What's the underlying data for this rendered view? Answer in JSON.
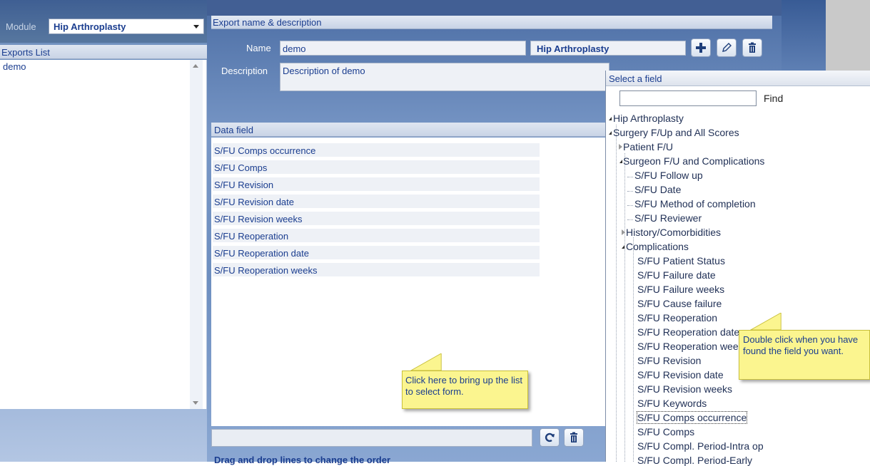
{
  "left_panel": {
    "module_label": "Module",
    "module_value": "Hip Arthroplasty",
    "exports_header": "Exports List",
    "exports": [
      "demo"
    ]
  },
  "export_section": {
    "header": "Export name & description",
    "name_label": "Name",
    "name_value": "demo",
    "module_name": "Hip Arthroplasty",
    "description_label": "Description",
    "description_value": "Description of demo",
    "toolbar_icons": [
      "plus-icon",
      "pencil-icon",
      "trash-icon"
    ]
  },
  "data_field": {
    "header": "Data field",
    "rows": [
      "S/FU Comps occurrence",
      "S/FU Comps",
      "S/FU Revision",
      "S/FU Revision date",
      "S/FU Revision weeks",
      "S/FU Reoperation",
      "S/FU Reoperation date",
      "S/FU Reoperation weeks"
    ],
    "bottom_icons": [
      "refresh-icon",
      "trash-icon"
    ],
    "drag_hint": "Drag and drop lines to change the order"
  },
  "callouts": {
    "form_hint": "Click here to bring up the list to select form.",
    "field_hint": "Double click when you have found the field you want."
  },
  "select_field": {
    "title": "Select a field",
    "search_value": "",
    "find_label": "Find",
    "tree": [
      "Hip Arthroplasty",
      "Surgery F/Up and All Scores",
      "Patient F/U",
      "Surgeon F/U and Complications",
      "S/FU Follow up",
      "S/FU Date",
      "S/FU Method of completion",
      "S/FU Reviewer",
      "History/Comorbidities",
      "Complications",
      "S/FU Patient Status",
      "S/FU Failure date",
      "S/FU Failure weeks",
      "S/FU Cause failure",
      "S/FU Reoperation",
      "S/FU Reoperation date",
      "S/FU Reoperation weeks",
      "S/FU Revision",
      "S/FU Revision date",
      "S/FU Revision weeks",
      "S/FU Keywords",
      "S/FU Comps occurrence",
      "S/FU Comps",
      "S/FU Compl. Period-Intra op",
      "S/FU Compl. Period-Early"
    ]
  },
  "colors": {
    "label_text": "#1a3d8f",
    "callout_bg": "#fbf58f",
    "header_blue": "#425f94"
  }
}
